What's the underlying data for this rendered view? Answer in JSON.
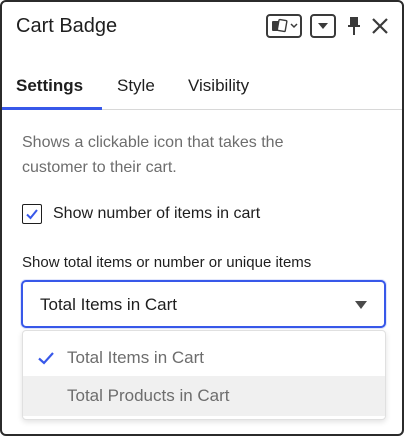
{
  "panel": {
    "title": "Cart Badge"
  },
  "header_icons": [
    "cards-icon",
    "chevron-down-icon",
    "pin-icon",
    "close-icon"
  ],
  "tabs": [
    {
      "label": "Settings",
      "active": true
    },
    {
      "label": "Style",
      "active": false
    },
    {
      "label": "Visibility",
      "active": false
    }
  ],
  "settings": {
    "description": "Shows a clickable icon that takes the customer to their cart.",
    "show_count": {
      "label": "Show number of items in cart",
      "checked": true
    },
    "count_type": {
      "label": "Show total items or number or unique items",
      "value": "Total Items in Cart",
      "options": [
        {
          "label": "Total Items in Cart",
          "selected": true
        },
        {
          "label": "Total Products in Cart",
          "selected": false
        }
      ]
    }
  },
  "colors": {
    "accent": "#3858e9",
    "muted_text": "#6d6d6d",
    "hover_bg": "#f0f0f0"
  }
}
